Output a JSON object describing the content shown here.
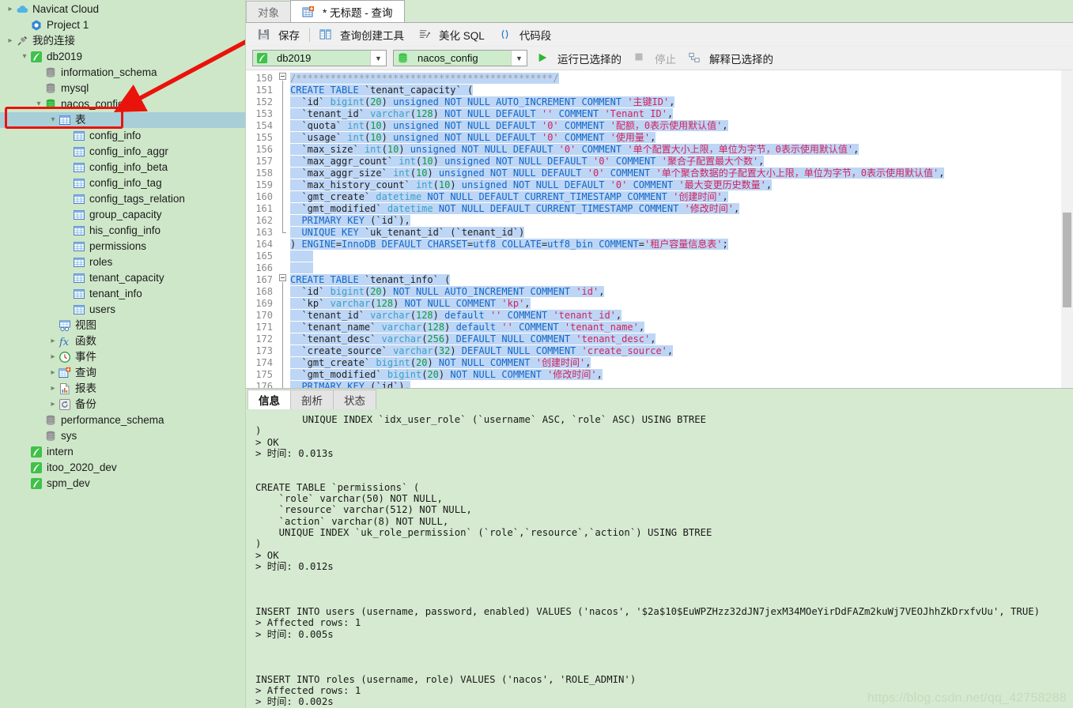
{
  "sidebar": {
    "items": [
      {
        "label": "Navicat Cloud",
        "icon": "cloud-icon",
        "indent": 0,
        "twisty": "collapsed",
        "selected": false
      },
      {
        "label": "Project 1",
        "icon": "project-icon",
        "indent": 1,
        "twisty": "none",
        "selected": false
      },
      {
        "label": "我的连接",
        "icon": "connection-icon",
        "indent": 0,
        "twisty": "collapsed",
        "selected": false
      },
      {
        "label": "db2019",
        "icon": "navicat-db-icon",
        "indent": 1,
        "twisty": "expanded",
        "selected": false
      },
      {
        "label": "information_schema",
        "icon": "database-icon",
        "indent": 2,
        "twisty": "none",
        "selected": false
      },
      {
        "label": "mysql",
        "icon": "database-icon",
        "indent": 2,
        "twisty": "none",
        "selected": false
      },
      {
        "label": "nacos_config",
        "icon": "database-green-icon",
        "indent": 2,
        "twisty": "expanded",
        "selected": false,
        "highlight": "red-box"
      },
      {
        "label": "表",
        "icon": "table-folder-icon",
        "indent": 3,
        "twisty": "expanded",
        "selected": true
      },
      {
        "label": "config_info",
        "icon": "table-icon",
        "indent": 4,
        "twisty": "none",
        "selected": false
      },
      {
        "label": "config_info_aggr",
        "icon": "table-icon",
        "indent": 4,
        "twisty": "none",
        "selected": false
      },
      {
        "label": "config_info_beta",
        "icon": "table-icon",
        "indent": 4,
        "twisty": "none",
        "selected": false
      },
      {
        "label": "config_info_tag",
        "icon": "table-icon",
        "indent": 4,
        "twisty": "none",
        "selected": false
      },
      {
        "label": "config_tags_relation",
        "icon": "table-icon",
        "indent": 4,
        "twisty": "none",
        "selected": false
      },
      {
        "label": "group_capacity",
        "icon": "table-icon",
        "indent": 4,
        "twisty": "none",
        "selected": false
      },
      {
        "label": "his_config_info",
        "icon": "table-icon",
        "indent": 4,
        "twisty": "none",
        "selected": false
      },
      {
        "label": "permissions",
        "icon": "table-icon",
        "indent": 4,
        "twisty": "none",
        "selected": false
      },
      {
        "label": "roles",
        "icon": "table-icon",
        "indent": 4,
        "twisty": "none",
        "selected": false
      },
      {
        "label": "tenant_capacity",
        "icon": "table-icon",
        "indent": 4,
        "twisty": "none",
        "selected": false
      },
      {
        "label": "tenant_info",
        "icon": "table-icon",
        "indent": 4,
        "twisty": "none",
        "selected": false
      },
      {
        "label": "users",
        "icon": "table-icon",
        "indent": 4,
        "twisty": "none",
        "selected": false
      },
      {
        "label": "视图",
        "icon": "view-icon",
        "indent": 3,
        "twisty": "none",
        "selected": false
      },
      {
        "label": "函数",
        "icon": "function-icon",
        "indent": 3,
        "twisty": "collapsed",
        "selected": false
      },
      {
        "label": "事件",
        "icon": "event-icon",
        "indent": 3,
        "twisty": "collapsed",
        "selected": false
      },
      {
        "label": "查询",
        "icon": "query-icon",
        "indent": 3,
        "twisty": "collapsed",
        "selected": false
      },
      {
        "label": "报表",
        "icon": "report-icon",
        "indent": 3,
        "twisty": "collapsed",
        "selected": false
      },
      {
        "label": "备份",
        "icon": "backup-icon",
        "indent": 3,
        "twisty": "collapsed",
        "selected": false
      },
      {
        "label": "performance_schema",
        "icon": "database-icon",
        "indent": 2,
        "twisty": "none",
        "selected": false
      },
      {
        "label": "sys",
        "icon": "database-icon",
        "indent": 2,
        "twisty": "none",
        "selected": false
      },
      {
        "label": "intern",
        "icon": "navicat-db-icon",
        "indent": 1,
        "twisty": "none",
        "selected": false
      },
      {
        "label": "itoo_2020_dev",
        "icon": "navicat-db-icon",
        "indent": 1,
        "twisty": "none",
        "selected": false
      },
      {
        "label": "spm_dev",
        "icon": "navicat-db-icon",
        "indent": 1,
        "twisty": "none",
        "selected": false
      }
    ]
  },
  "tabs": [
    {
      "label": "对象",
      "active": false,
      "icon": "none"
    },
    {
      "label": "* 无标题 - 查询",
      "active": true,
      "icon": "query-icon"
    }
  ],
  "toolbar": {
    "save_label": "保存",
    "query_builder_label": "查询创建工具",
    "beautify_sql_label": "美化 SQL",
    "snippet_label": "代码段"
  },
  "toolbar2": {
    "connection_value": "db2019",
    "database_value": "nacos_config",
    "run_selected_label": "运行已选择的",
    "stop_label": "停止",
    "explain_selected_label": "解释已选择的"
  },
  "editor": {
    "first_line": 150,
    "lines": [
      {
        "n": 150,
        "html": "<span class=\"hl\"><span class=\"c\">/*********************************************/</span></span>"
      },
      {
        "n": 151,
        "html": "<span class=\"hl\"><span class=\"k\">CREATE TABLE</span> <span class=\"p\">`tenant_capacity` (</span></span>"
      },
      {
        "n": 152,
        "html": "<span class=\"hl\"><span class=\"p\">  `id`</span> <span class=\"t\">bigint</span><span class=\"p\">(</span><span class=\"n\">20</span><span class=\"p\">)</span> <span class=\"k\">unsigned NOT NULL AUTO_INCREMENT COMMENT</span> <span class=\"s\">'主键ID'</span><span class=\"p\">,</span></span>"
      },
      {
        "n": 153,
        "html": "<span class=\"hl\"><span class=\"p\">  `tenant_id`</span> <span class=\"t\">varchar</span><span class=\"p\">(</span><span class=\"n\">128</span><span class=\"p\">)</span> <span class=\"k\">NOT NULL DEFAULT</span> <span class=\"s\">''</span> <span class=\"k\">COMMENT</span> <span class=\"s\">'Tenant ID'</span><span class=\"p\">,</span></span>"
      },
      {
        "n": 154,
        "html": "<span class=\"hl\"><span class=\"p\">  `quota`</span> <span class=\"t\">int</span><span class=\"p\">(</span><span class=\"n\">10</span><span class=\"p\">)</span> <span class=\"k\">unsigned NOT NULL DEFAULT</span> <span class=\"s\">'0'</span> <span class=\"k\">COMMENT</span> <span class=\"s\">'配额，0表示使用默认值'</span><span class=\"p\">,</span></span>"
      },
      {
        "n": 155,
        "html": "<span class=\"hl\"><span class=\"p\">  `usage`</span> <span class=\"t\">int</span><span class=\"p\">(</span><span class=\"n\">10</span><span class=\"p\">)</span> <span class=\"k\">unsigned NOT NULL DEFAULT</span> <span class=\"s\">'0'</span> <span class=\"k\">COMMENT</span> <span class=\"s\">'使用量'</span><span class=\"p\">,</span></span>"
      },
      {
        "n": 156,
        "html": "<span class=\"hl\"><span class=\"p\">  `max_size`</span> <span class=\"t\">int</span><span class=\"p\">(</span><span class=\"n\">10</span><span class=\"p\">)</span> <span class=\"k\">unsigned NOT NULL DEFAULT</span> <span class=\"s\">'0'</span> <span class=\"k\">COMMENT</span> <span class=\"s\">'单个配置大小上限，单位为字节，0表示使用默认值'</span><span class=\"p\">,</span></span>"
      },
      {
        "n": 157,
        "html": "<span class=\"hl\"><span class=\"p\">  `max_aggr_count`</span> <span class=\"t\">int</span><span class=\"p\">(</span><span class=\"n\">10</span><span class=\"p\">)</span> <span class=\"k\">unsigned NOT NULL DEFAULT</span> <span class=\"s\">'0'</span> <span class=\"k\">COMMENT</span> <span class=\"s\">'聚合子配置最大个数'</span><span class=\"p\">,</span></span>"
      },
      {
        "n": 158,
        "html": "<span class=\"hl\"><span class=\"p\">  `max_aggr_size`</span> <span class=\"t\">int</span><span class=\"p\">(</span><span class=\"n\">10</span><span class=\"p\">)</span> <span class=\"k\">unsigned NOT NULL DEFAULT</span> <span class=\"s\">'0'</span> <span class=\"k\">COMMENT</span> <span class=\"s\">'单个聚合数据的子配置大小上限，单位为字节，0表示使用默认值'</span><span class=\"p\">,</span></span>"
      },
      {
        "n": 159,
        "html": "<span class=\"hl\"><span class=\"p\">  `max_history_count`</span> <span class=\"t\">int</span><span class=\"p\">(</span><span class=\"n\">10</span><span class=\"p\">)</span> <span class=\"k\">unsigned NOT NULL DEFAULT</span> <span class=\"s\">'0'</span> <span class=\"k\">COMMENT</span> <span class=\"s\">'最大变更历史数量'</span><span class=\"p\">,</span></span>"
      },
      {
        "n": 160,
        "html": "<span class=\"hl\"><span class=\"p\">  `gmt_create`</span> <span class=\"t\">datetime</span> <span class=\"k\">NOT NULL DEFAULT CURRENT_TIMESTAMP COMMENT</span> <span class=\"s\">'创建时间'</span><span class=\"p\">,</span></span>"
      },
      {
        "n": 161,
        "html": "<span class=\"hl\"><span class=\"p\">  `gmt_modified`</span> <span class=\"t\">datetime</span> <span class=\"k\">NOT NULL DEFAULT CURRENT_TIMESTAMP COMMENT</span> <span class=\"s\">'修改时间'</span><span class=\"p\">,</span></span>"
      },
      {
        "n": 162,
        "html": "<span class=\"hl\"><span class=\"p\">  </span><span class=\"k\">PRIMARY KEY</span> <span class=\"p\">(`id`),</span></span>"
      },
      {
        "n": 163,
        "html": "<span class=\"hl\"><span class=\"p\">  </span><span class=\"k\">UNIQUE KEY</span> <span class=\"p\">`uk_tenant_id` (`tenant_id`)</span></span>"
      },
      {
        "n": 164,
        "html": "<span class=\"hl\"><span class=\"p\">) </span><span class=\"k\">ENGINE</span><span class=\"p\">=</span><span class=\"k\">InnoDB DEFAULT CHARSET</span><span class=\"p\">=</span><span class=\"k\">utf8 COLLATE</span><span class=\"p\">=</span><span class=\"k\">utf8_bin COMMENT</span><span class=\"p\">=</span><span class=\"s\">'租户容量信息表'</span><span class=\"p\">;</span></span>"
      },
      {
        "n": 165,
        "html": "<span class=\"hl\">    </span>"
      },
      {
        "n": 166,
        "html": "<span class=\"hl\">    </span>"
      },
      {
        "n": 167,
        "html": "<span class=\"hl\"><span class=\"k\">CREATE TABLE</span> <span class=\"p\">`tenant_info` (</span></span>"
      },
      {
        "n": 168,
        "html": "<span class=\"hl\"><span class=\"p\">  `id`</span> <span class=\"t\">bigint</span><span class=\"p\">(</span><span class=\"n\">20</span><span class=\"p\">)</span> <span class=\"k\">NOT NULL AUTO_INCREMENT COMMENT</span> <span class=\"s\">'id'</span><span class=\"p\">,</span></span>"
      },
      {
        "n": 169,
        "html": "<span class=\"hl\"><span class=\"p\">  `kp`</span> <span class=\"t\">varchar</span><span class=\"p\">(</span><span class=\"n\">128</span><span class=\"p\">)</span> <span class=\"k\">NOT NULL COMMENT</span> <span class=\"s\">'kp'</span><span class=\"p\">,</span></span>"
      },
      {
        "n": 170,
        "html": "<span class=\"hl\"><span class=\"p\">  `tenant_id`</span> <span class=\"t\">varchar</span><span class=\"p\">(</span><span class=\"n\">128</span><span class=\"p\">)</span> <span class=\"k\">default</span> <span class=\"s\">''</span> <span class=\"k\">COMMENT</span> <span class=\"s\">'tenant_id'</span><span class=\"p\">,</span></span>"
      },
      {
        "n": 171,
        "html": "<span class=\"hl\"><span class=\"p\">  `tenant_name`</span> <span class=\"t\">varchar</span><span class=\"p\">(</span><span class=\"n\">128</span><span class=\"p\">)</span> <span class=\"k\">default</span> <span class=\"s\">''</span> <span class=\"k\">COMMENT</span> <span class=\"s\">'tenant_name'</span><span class=\"p\">,</span></span>"
      },
      {
        "n": 172,
        "html": "<span class=\"hl\"><span class=\"p\">  `tenant_desc`</span> <span class=\"t\">varchar</span><span class=\"p\">(</span><span class=\"n\">256</span><span class=\"p\">)</span> <span class=\"k\">DEFAULT NULL COMMENT</span> <span class=\"s\">'tenant_desc'</span><span class=\"p\">,</span></span>"
      },
      {
        "n": 173,
        "html": "<span class=\"hl\"><span class=\"p\">  `create_source`</span> <span class=\"t\">varchar</span><span class=\"p\">(</span><span class=\"n\">32</span><span class=\"p\">)</span> <span class=\"k\">DEFAULT NULL COMMENT</span> <span class=\"s\">'create_source'</span><span class=\"p\">,</span></span>"
      },
      {
        "n": 174,
        "html": "<span class=\"hl\"><span class=\"p\">  `gmt_create`</span> <span class=\"t\">bigint</span><span class=\"p\">(</span><span class=\"n\">20</span><span class=\"p\">)</span> <span class=\"k\">NOT NULL COMMENT</span> <span class=\"s\">'创建时间'</span><span class=\"p\">,</span></span>"
      },
      {
        "n": 175,
        "html": "<span class=\"hl\"><span class=\"p\">  `gmt_modified`</span> <span class=\"t\">bigint</span><span class=\"p\">(</span><span class=\"n\">20</span><span class=\"p\">)</span> <span class=\"k\">NOT NULL COMMENT</span> <span class=\"s\">'修改时间'</span><span class=\"p\">,</span></span>"
      },
      {
        "n": 176,
        "html": "<span class=\"hl\"><span class=\"p\">  </span><span class=\"k\">PRIMARY KEY</span> <span class=\"p\">(`id`),</span></span>"
      }
    ]
  },
  "results": {
    "tabs": [
      {
        "label": "信息",
        "active": true
      },
      {
        "label": "剖析",
        "active": false
      },
      {
        "label": "状态",
        "active": false
      }
    ],
    "lines": [
      "        UNIQUE INDEX `idx_user_role` (`username` ASC, `role` ASC) USING BTREE",
      ")",
      "> OK",
      "> 时间: 0.013s",
      "",
      "",
      "CREATE TABLE `permissions` (",
      "    `role` varchar(50) NOT NULL,",
      "    `resource` varchar(512) NOT NULL,",
      "    `action` varchar(8) NOT NULL,",
      "    UNIQUE INDEX `uk_role_permission` (`role`,`resource`,`action`) USING BTREE",
      ")",
      "> OK",
      "> 时间: 0.012s",
      "",
      "",
      "",
      "INSERT INTO users (username, password, enabled) VALUES ('nacos', '$2a$10$EuWPZHzz32dJN7jexM34MOeYirDdFAZm2kuWj7VEOJhhZkDrxfvUu', TRUE)",
      "> Affected rows: 1",
      "> 时间: 0.005s",
      "",
      "",
      "",
      "INSERT INTO roles (username, role) VALUES ('nacos', 'ROLE_ADMIN')",
      "> Affected rows: 1",
      "> 时间: 0.002s"
    ]
  },
  "watermark": "https://blog.csdn.net/qq_42758288",
  "colors": {
    "sidebar_bg": "#cfe7c9",
    "selection_blue": "#bed6f5",
    "tree_selection": "#a8cfd8",
    "annotation_red": "#e8140c",
    "results_bg": "#d5ead0",
    "keyword_blue": "#1267c8",
    "string_red": "#d0235e",
    "number_green": "#0f9a3d"
  }
}
